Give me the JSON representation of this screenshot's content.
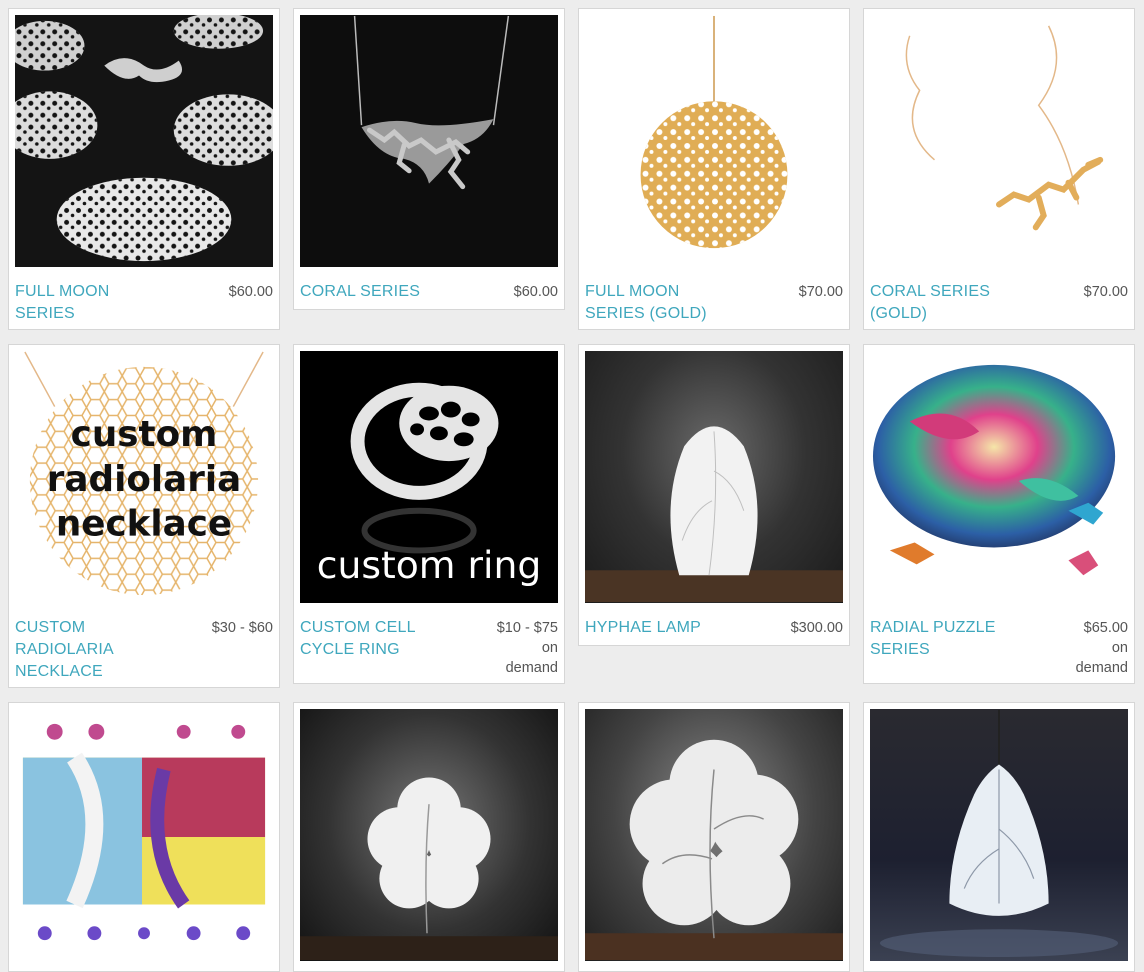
{
  "products": [
    {
      "title": "FULL MOON SERIES",
      "price": "$60.00"
    },
    {
      "title": "CORAL SERIES",
      "price": "$60.00"
    },
    {
      "title": "FULL MOON SERIES (GOLD)",
      "price": "$70.00"
    },
    {
      "title": "CORAL SERIES (GOLD)",
      "price": "$70.00"
    },
    {
      "title": "CUSTOM RADIOLARIA NECKLACE",
      "price": "$30 - $60",
      "image_text": [
        "custom",
        "radiolaria",
        "necklace"
      ]
    },
    {
      "title": "CUSTOM CELL CYCLE RING",
      "price": "$10 - $75\non\ndemand",
      "image_text": "custom ring"
    },
    {
      "title": "HYPHAE LAMP",
      "price": "$300.00"
    },
    {
      "title": "RADIAL PUZZLE SERIES",
      "price": "$65.00\non\ndemand"
    },
    {
      "title": "",
      "price": ""
    },
    {
      "title": "",
      "price": ""
    },
    {
      "title": "",
      "price": ""
    },
    {
      "title": "",
      "price": ""
    }
  ],
  "colors": {
    "link": "#3fa7bd",
    "price": "#555555",
    "gold": "#e0ad55",
    "card_border": "#d6d6d6"
  }
}
